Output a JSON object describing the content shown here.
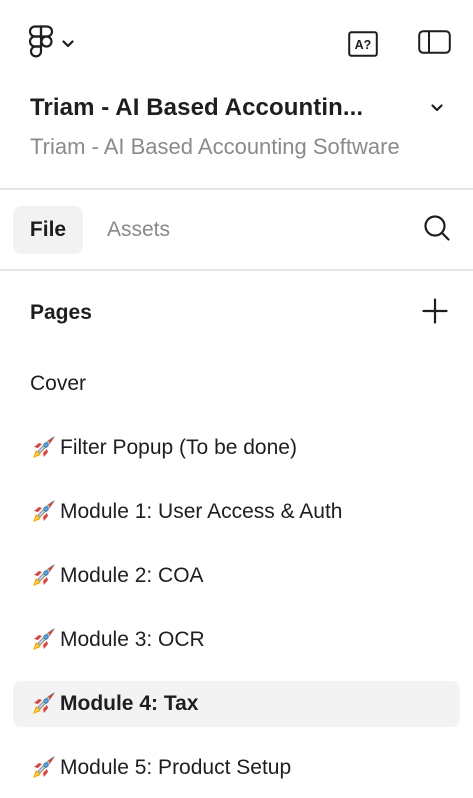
{
  "file": {
    "title": "Triam - AI Based Accountin...",
    "subtitle": "Triam - AI Based Accounting Software"
  },
  "toolbar": {
    "menu_icon": "figma-logo-icon",
    "font_check_label": "A?"
  },
  "tabs": [
    {
      "label": "File",
      "active": true
    },
    {
      "label": "Assets",
      "active": false
    }
  ],
  "pages": {
    "title": "Pages",
    "items": [
      {
        "label": "Cover",
        "icon": "",
        "selected": false
      },
      {
        "label": "Filter Popup (To be done)",
        "icon": "rocket-icon",
        "selected": false
      },
      {
        "label": "Module 1: User Access & Auth",
        "icon": "rocket-icon",
        "selected": false
      },
      {
        "label": "Module 2: COA",
        "icon": "rocket-icon",
        "selected": false
      },
      {
        "label": "Module 3: OCR",
        "icon": "rocket-icon",
        "selected": false
      },
      {
        "label": "Module 4: Tax",
        "icon": "rocket-icon",
        "selected": true
      },
      {
        "label": "Module 5: Product Setup",
        "icon": "rocket-icon",
        "selected": false
      }
    ]
  },
  "colors": {
    "text": "#1e1e1e",
    "muted": "#8a8a8a",
    "selected_bg": "#f3f3f3",
    "divider": "#e6e6e6"
  }
}
